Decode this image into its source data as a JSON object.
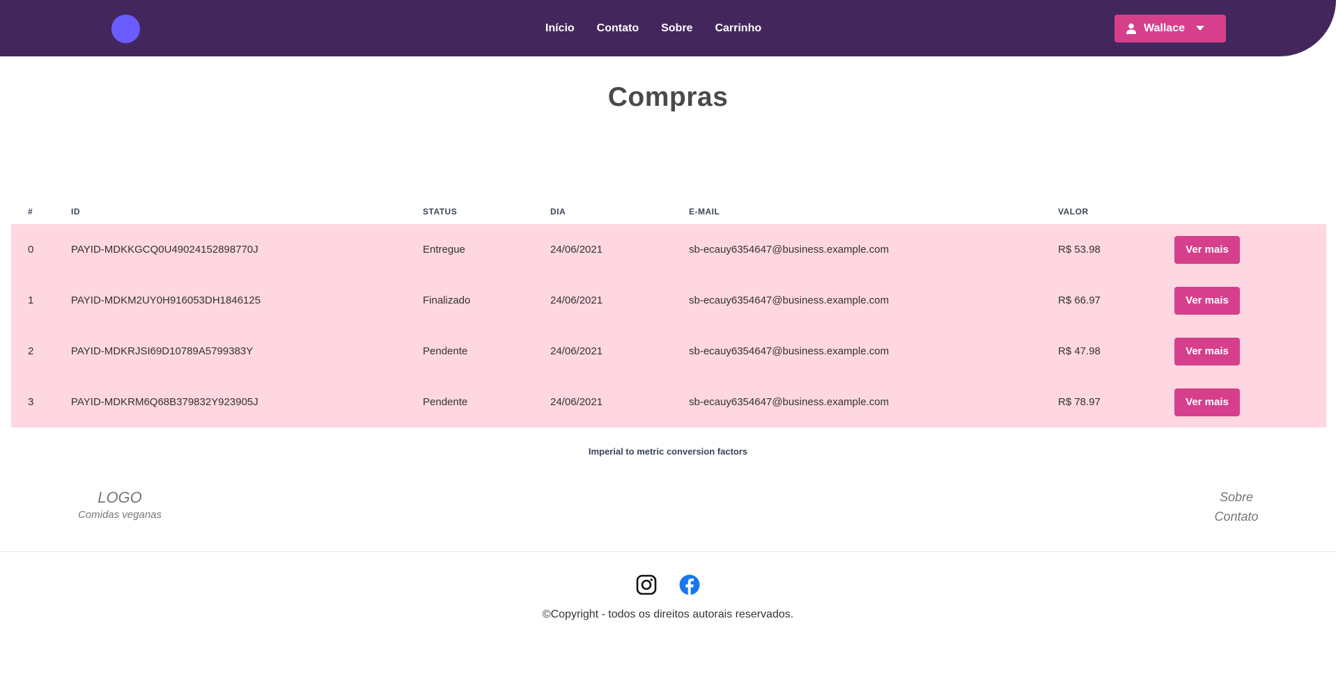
{
  "header": {
    "nav": [
      "Início",
      "Contato",
      "Sobre",
      "Carrinho"
    ],
    "user_name": "Wallace",
    "colors": {
      "background": "#43275c",
      "accent": "#d63f8c",
      "logo": "#6a5cff"
    }
  },
  "page": {
    "title": "Compras"
  },
  "table": {
    "columns": [
      "#",
      "ID",
      "STATUS",
      "DIA",
      "E-MAIL",
      "VALOR"
    ],
    "row_color": "#ffd7e1",
    "rows": [
      {
        "num": "0",
        "id": "PAYID-MDKKGCQ0U49024152898770J",
        "status": "Entregue",
        "dia": "24/06/2021",
        "email": "sb-ecauy6354647@business.example.com",
        "valor": "R$ 53.98",
        "action": "Ver mais"
      },
      {
        "num": "1",
        "id": "PAYID-MDKM2UY0H916053DH1846125",
        "status": "Finalizado",
        "dia": "24/06/2021",
        "email": "sb-ecauy6354647@business.example.com",
        "valor": "R$ 66.97",
        "action": "Ver mais"
      },
      {
        "num": "2",
        "id": "PAYID-MDKRJSI69D10789A5799383Y",
        "status": "Pendente",
        "dia": "24/06/2021",
        "email": "sb-ecauy6354647@business.example.com",
        "valor": "R$ 47.98",
        "action": "Ver mais"
      },
      {
        "num": "3",
        "id": "PAYID-MDKRM6Q68B379832Y923905J",
        "status": "Pendente",
        "dia": "24/06/2021",
        "email": "sb-ecauy6354647@business.example.com",
        "valor": "R$ 78.97",
        "action": "Ver mais"
      }
    ],
    "caption": "Imperial to metric conversion factors"
  },
  "footer": {
    "logo": "LOGO",
    "tagline": "Comidas veganas",
    "links": [
      "Sobre",
      "Contato"
    ],
    "social_icons": [
      "instagram-icon",
      "facebook-icon"
    ],
    "copyright": "©Copyright - todos os direitos autorais reservados."
  }
}
